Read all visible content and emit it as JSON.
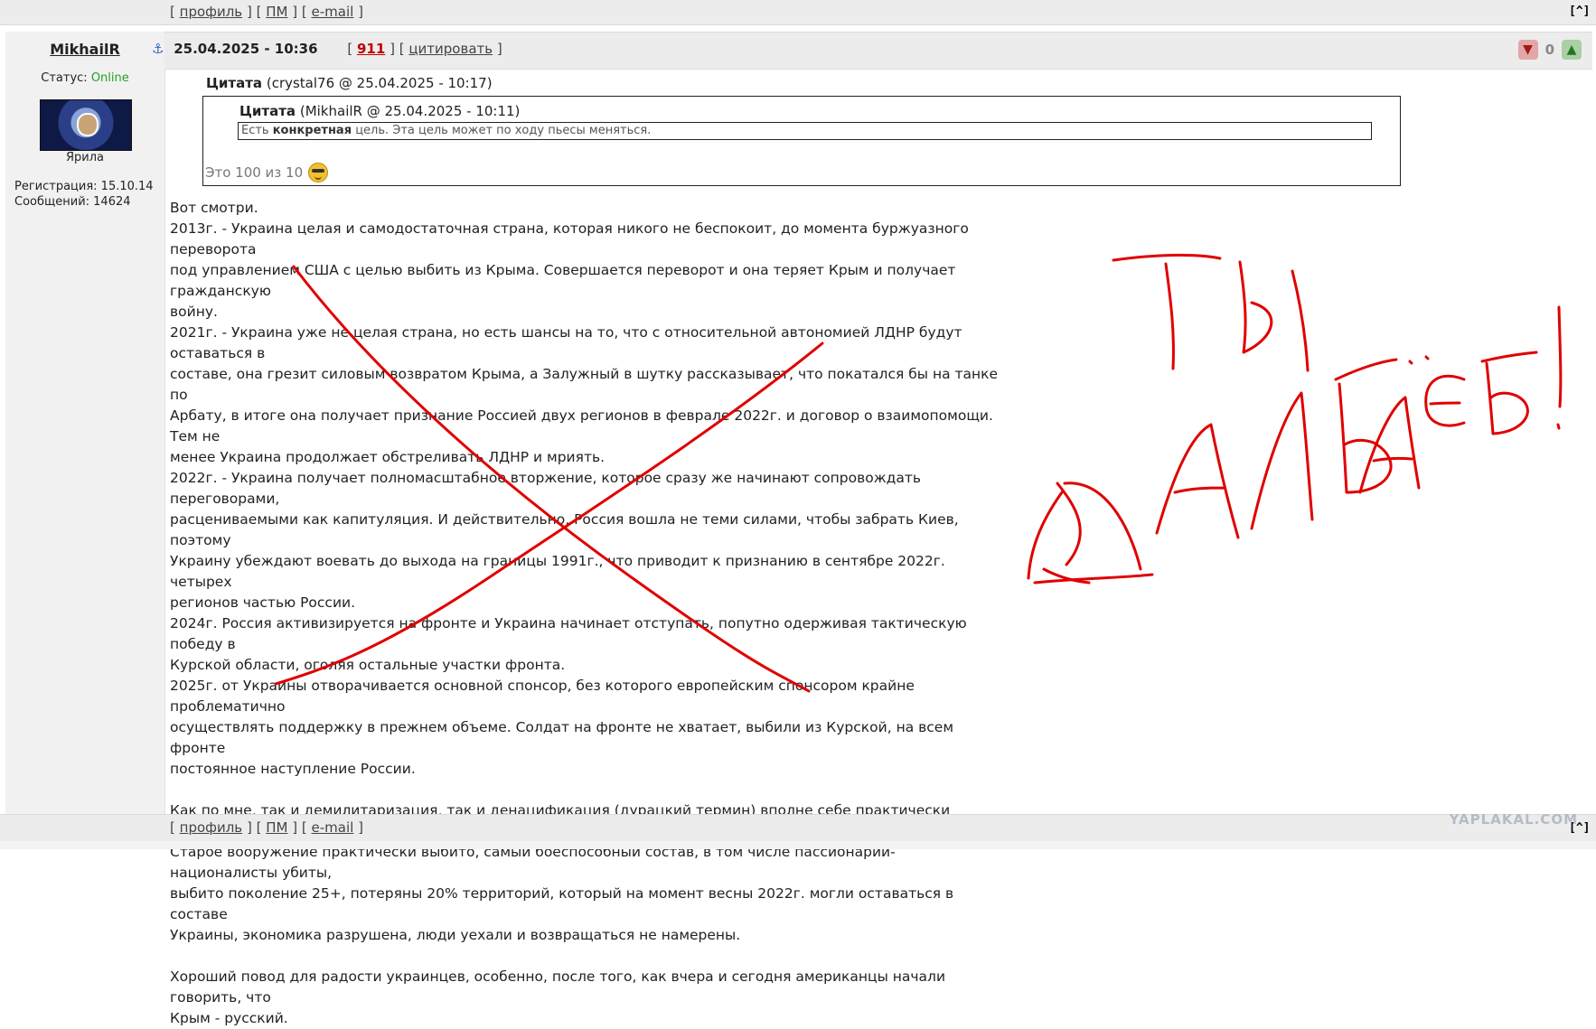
{
  "nav": {
    "open_bracket": "[",
    "close_bracket": "]",
    "profile": "профиль",
    "pm": "ПМ",
    "email": "e-mail",
    "up": "[^]"
  },
  "user": {
    "name": "MikhailR",
    "status_label": "Статус:",
    "status_value": "Online",
    "title": "Ярила",
    "registration": "Регистрация: 15.10.14",
    "messages": "Сообщений: 14624"
  },
  "post": {
    "datetime": "25.04.2025 - 10:36",
    "id": "911",
    "quote_label": "цитировать",
    "rating": "0"
  },
  "quote": {
    "outer_label": "Цитата",
    "outer_meta": "(crystal76 @ 25.04.2025 - 10:17)",
    "inner_label": "Цитата",
    "inner_meta": "(MikhailR @ 25.04.2025 - 10:11)",
    "inner_text_before": "Есть ",
    "inner_text_bold": "конкретная",
    "inner_text_after": " цель. Эта цель может по ходу пьесы меняться.",
    "reply": "Это 100 из 10"
  },
  "body": [
    "Вот смотри.",
    "2013г. - Украина целая и самодостаточная страна, которая никого не беспокоит, до момента буржуазного переворота",
    "под управлением США с целью выбить из Крыма. Совершается переворот и она теряет Крым и получает гражданскую",
    "войну.",
    "2021г. - Украина уже не целая страна, но есть шансы на то, что с относительной автономией ЛДНР будут оставаться в",
    "составе, она грезит силовым возвратом Крыма, а Залужный в шутку рассказывает, что покатался бы на танке по",
    "Арбату, в итоге она получает признание Россией двух регионов в феврале 2022г. и договор о взаимопомощи. Тем не",
    "менее Украина продолжает обстреливать ЛДНР и мриять.",
    "2022г. - Украина получает полномасштабное вторжение, которое сразу же начинают сопровождать переговорами,",
    "расцениваемыми как капитуляция. И действительно, Россия вошла не теми силами, чтобы забрать Киев, поэтому",
    "Украину убеждают воевать до выхода на границы 1991г., что приводит к признанию в сентябре 2022г. четырех",
    "регионов частью России.",
    "2024г. Россия активизируется на фронте и Украина начинает отступать, попутно одерживая тактическую победу в",
    "Курской области, оголяя остальные участки фронта.",
    "2025г. от Украины отворачивается основной спонсор, без которого европейским спонсором крайне проблематично",
    "осуществлять поддержку в прежнем объеме. Солдат на фронте не хватает, выбили из Курской, на всем фронте",
    "постоянное наступление России.",
    "",
    "Как по мне, так и демилитаризация, так и денацификация (дурацкий термин) вполне себе практически состоялись.",
    "Старое вооружение практически выбито, самый боеспособный состав, в том числе пассионарии-националисты убиты,",
    "выбито поколение 25+, потеряны 20% территорий, который на момент весны 2022г. могли оставаться в составе",
    "Украины, экономика разрушена, люди уехали и возвращаться не намерены.",
    "",
    "Хороший повод для радости украинцев, особенно, после того, как вчера и сегодня американцы начали говорить, что",
    "Крым - русский."
  ],
  "watermark": "YAPLAKAL.COM",
  "colors": {
    "online": "#22a322",
    "post_id": "#c00000",
    "annotation_red": "#e00000"
  }
}
